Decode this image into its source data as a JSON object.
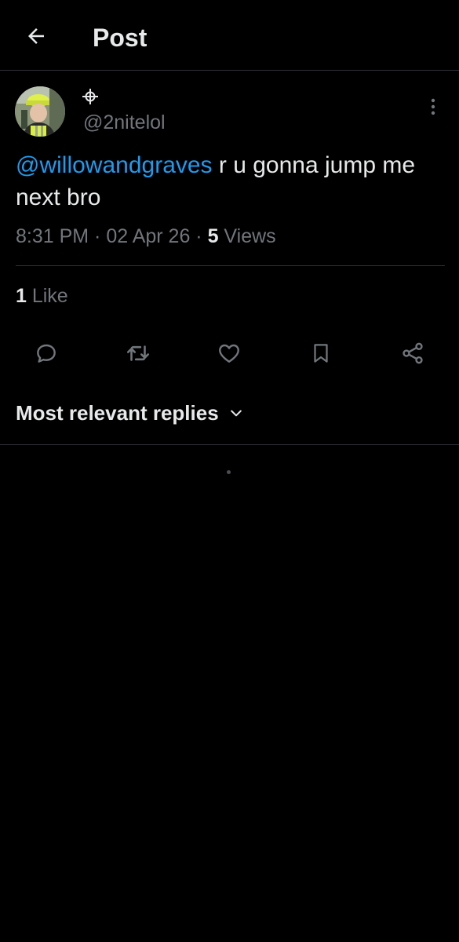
{
  "header": {
    "title": "Post",
    "back_icon": "arrow-left-icon"
  },
  "post": {
    "author_badge_icon": "crosshair-icon",
    "handle": "@2nitelol",
    "mention": "@willowandgraves",
    "text": " r u gonna jump me next bro",
    "time": "8:31 PM",
    "sep1": " · ",
    "date": "02 Apr 26",
    "sep2": " · ",
    "views_count": "5",
    "views_label": " Views",
    "likes_count": "1",
    "likes_label": " Like"
  },
  "actions": {
    "reply_icon": "reply-icon",
    "repost_icon": "repost-icon",
    "like_icon": "heart-icon",
    "bookmark_icon": "bookmark-icon",
    "share_icon": "share-icon"
  },
  "replies": {
    "sort_label": "Most relevant replies"
  },
  "colors": {
    "background": "#000000",
    "text": "#e7e9ea",
    "secondary": "#71767b",
    "accent": "#1d9bf0",
    "divider": "#2f3336"
  }
}
